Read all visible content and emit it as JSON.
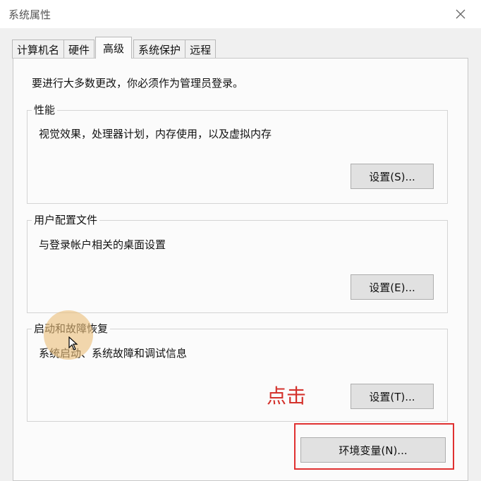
{
  "window": {
    "title": "系统属性"
  },
  "tabs": [
    {
      "label": "计算机名"
    },
    {
      "label": "硬件"
    },
    {
      "label": "高级"
    },
    {
      "label": "系统保护"
    },
    {
      "label": "远程"
    }
  ],
  "active_tab": "高级",
  "intro": "要进行大多数更改，你必须作为管理员登录。",
  "groups": {
    "performance": {
      "title": "性能",
      "desc": "视觉效果，处理器计划，内存使用，以及虚拟内存",
      "button": "设置(S)..."
    },
    "user_profiles": {
      "title": "用户配置文件",
      "desc": "与登录帐户相关的桌面设置",
      "button": "设置(E)..."
    },
    "startup_recovery": {
      "title": "启动和故障恢复",
      "desc": "系统启动、系统故障和调试信息",
      "button": "设置(T)..."
    }
  },
  "env_button": "环境变量(N)...",
  "annotation": "点击",
  "colors": {
    "annotation": "#d4322c",
    "highlight_box": "#e03030"
  },
  "icons": {
    "close": "close-icon",
    "cursor": "mouse-cursor-icon"
  }
}
